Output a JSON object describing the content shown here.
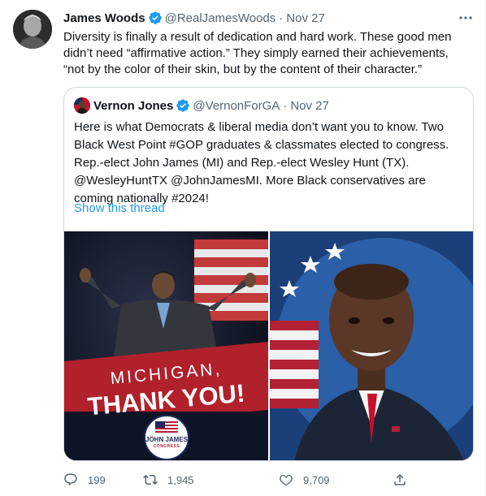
{
  "tweet": {
    "author_name": "James Woods",
    "handle": "@RealJamesWoods",
    "separator": "·",
    "time": "Nov 27",
    "more_label": "···",
    "text": "Diversity is finally a result of dedication and hard work. These good men didn’t need “affirmative action.” They simply earned their achievements, “not by the color of their skin, but by the content of their character.”"
  },
  "quote": {
    "author_name": "Vernon Jones",
    "handle": "@VernonForGA",
    "separator": "·",
    "time": "Nov 27",
    "text": "Here is what Democrats & liberal media don’t want you to know. Two Black West Point #GOP graduates & classmates elected to congress. Rep.-elect John James (MI) and Rep.-elect Wesley Hunt (TX). @WesleyHuntTX @JohnJamesMI. More Black conservatives are coming nationally #2024!",
    "show_thread": "Show this thread",
    "media": {
      "left": {
        "headline_top": "MICHIGAN,",
        "headline_bottom": "THANK YOU!",
        "badge_name": "JOHN JAMES",
        "badge_sub": "CONGRESS"
      }
    }
  },
  "actions": {
    "replies": "199",
    "retweets": "1,945",
    "likes": "9,709"
  },
  "colors": {
    "accent": "#1d9bf0",
    "muted": "#536471",
    "border": "#cfd9de",
    "banner_red": "#b0212b"
  },
  "icons": [
    "verified-badge-icon",
    "more-icon",
    "reply-icon",
    "retweet-icon",
    "like-icon",
    "share-icon"
  ]
}
